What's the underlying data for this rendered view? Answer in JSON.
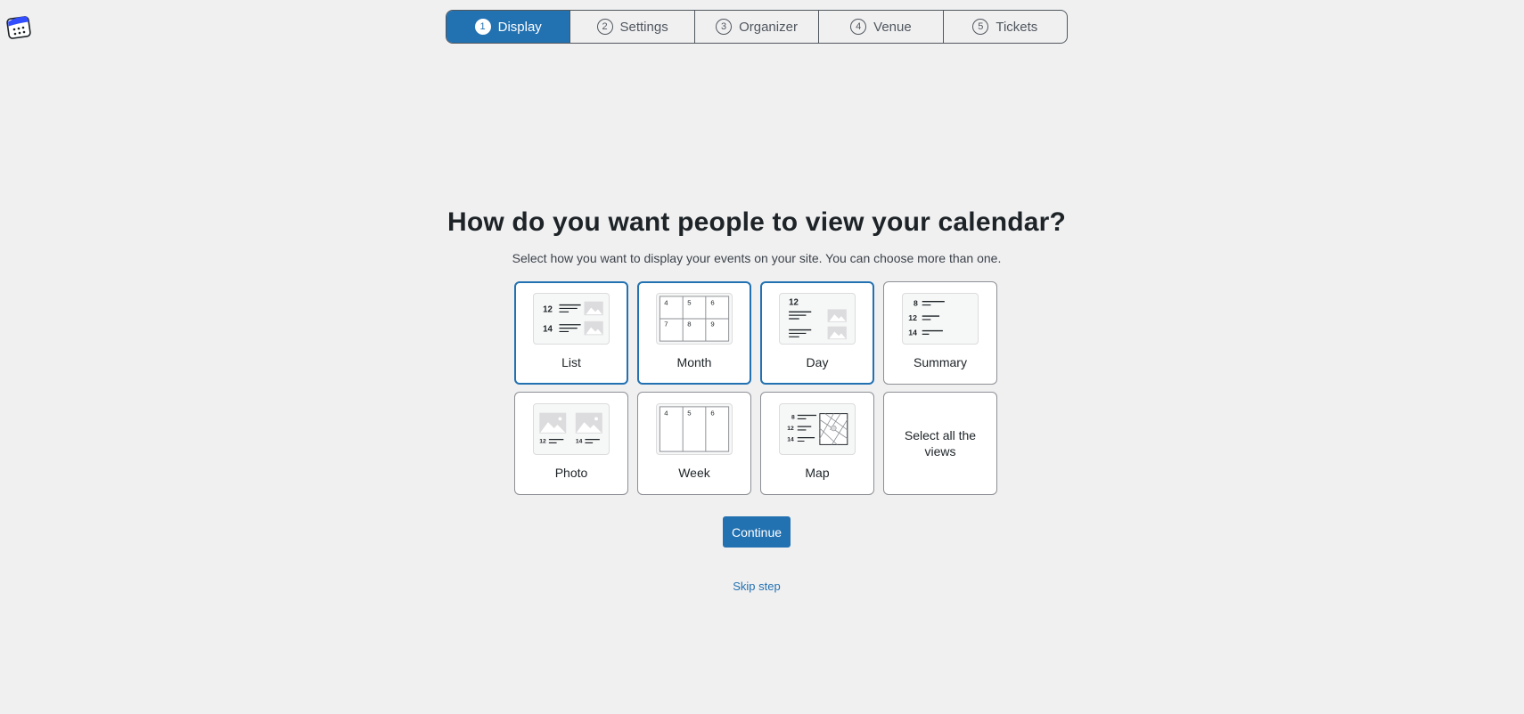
{
  "app": {
    "logo_icon": "calendar-logo-icon"
  },
  "stepper": {
    "steps": [
      {
        "num": "1",
        "label": "Display",
        "active": true
      },
      {
        "num": "2",
        "label": "Settings",
        "active": false
      },
      {
        "num": "3",
        "label": "Organizer",
        "active": false
      },
      {
        "num": "4",
        "label": "Venue",
        "active": false
      },
      {
        "num": "5",
        "label": "Tickets",
        "active": false
      }
    ]
  },
  "main": {
    "title": "How do you want people to view your calendar?",
    "subtitle": "Select how you want to display your events on your site. You can choose more than one.",
    "views": [
      {
        "label": "List",
        "selected": true,
        "icon": "list-view-icon"
      },
      {
        "label": "Month",
        "selected": true,
        "icon": "month-view-icon"
      },
      {
        "label": "Day",
        "selected": true,
        "icon": "day-view-icon"
      },
      {
        "label": "Summary",
        "selected": false,
        "icon": "summary-view-icon"
      },
      {
        "label": "Photo",
        "selected": false,
        "icon": "photo-view-icon"
      },
      {
        "label": "Week",
        "selected": false,
        "icon": "week-view-icon"
      },
      {
        "label": "Map",
        "selected": false,
        "icon": "map-view-icon"
      },
      {
        "label": "Select all the views",
        "selected": false
      }
    ],
    "thumb_text": {
      "list": [
        "12",
        "14"
      ],
      "month": [
        "4",
        "5",
        "6",
        "7",
        "8",
        "9"
      ],
      "day": [
        "12"
      ],
      "summary": [
        "8",
        "12",
        "14"
      ],
      "photo": [
        "12",
        "14"
      ],
      "week": [
        "4",
        "5",
        "6"
      ],
      "map": [
        "8",
        "12",
        "14"
      ]
    },
    "continue_label": "Continue",
    "skip_label": "Skip step"
  },
  "colors": {
    "accent": "#2271b1",
    "background": "#f0f0f1",
    "text": "#1d2327"
  }
}
